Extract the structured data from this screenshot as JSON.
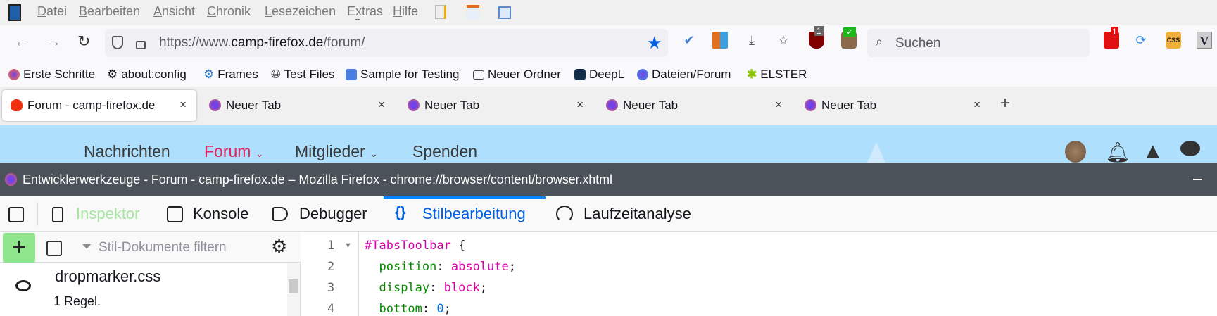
{
  "menubar": {
    "items": [
      "Datei",
      "Bearbeiten",
      "Ansicht",
      "Chronik",
      "Lesezeichen",
      "Extras",
      "Hilfe"
    ],
    "accelerators": [
      "D",
      "B",
      "A",
      "C",
      "L",
      "t",
      "H"
    ]
  },
  "navbar": {
    "url_prefix": "https://www.",
    "url_domain": "camp-firefox.de",
    "url_path": "/forum/",
    "search_placeholder": "Suchen",
    "ublock_badge": "1",
    "ext_badge": "1"
  },
  "bookmarks": [
    "Erste Schritte",
    "about:config",
    "Frames",
    "Test Files",
    "Sample for Testing",
    "Neuer Ordner",
    "DeepL",
    "Dateien/Forum",
    "ELSTER"
  ],
  "tabs": [
    {
      "title": "Forum - camp-firefox.de",
      "active": true
    },
    {
      "title": "Neuer Tab"
    },
    {
      "title": "Neuer Tab"
    },
    {
      "title": "Neuer Tab"
    },
    {
      "title": "Neuer Tab"
    }
  ],
  "web": {
    "nav": [
      "Nachrichten",
      "Forum",
      "Mitglieder",
      "Spenden"
    ],
    "active_color": "#e0245e"
  },
  "devtools": {
    "window_title": "Entwicklerwerkzeuge - Forum - camp-firefox.de – Mozilla Firefox - chrome://browser/content/browser.xhtml",
    "tabs": [
      "Inspektor",
      "Konsole",
      "Debugger",
      "Stilbearbeitung",
      "Laufzeitanalyse"
    ],
    "active_tab": "Stilbearbeitung",
    "filter_placeholder": "Stil-Dokumente filtern",
    "stylesheets": [
      {
        "name": "dropmarker.css",
        "rules": "1 Regel."
      }
    ],
    "code": [
      {
        "n": "1",
        "sel": "#TabsToolbar",
        "rest": " {"
      },
      {
        "n": "2",
        "prop": "position",
        "val": "absolute"
      },
      {
        "n": "3",
        "prop": "display",
        "val": "block"
      },
      {
        "n": "4",
        "prop": "bottom",
        "val": "0"
      }
    ]
  }
}
